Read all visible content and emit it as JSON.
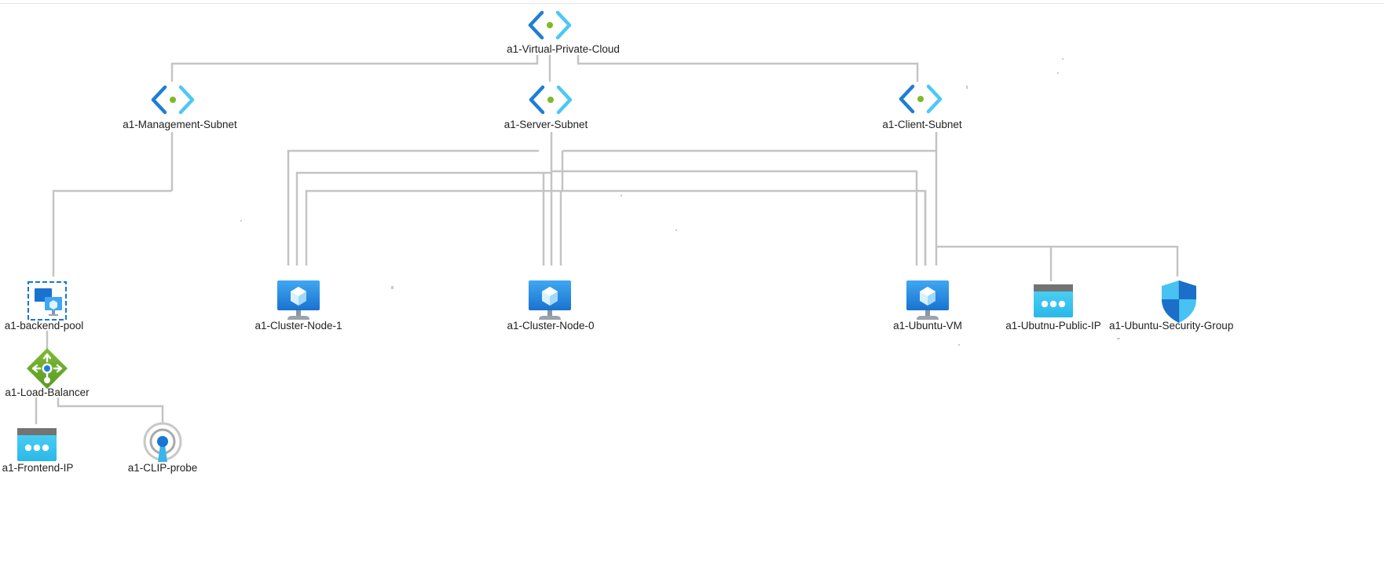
{
  "diagram": {
    "colors": {
      "connector": "#c4c4c4",
      "label_text": "#222222",
      "network_blue_dark": "#1e7ed6",
      "network_blue_light": "#4cc8f4",
      "network_dot": "#7fb927",
      "vm_screen": "#1e7ed6",
      "vm_screen_light": "#37a4f0",
      "vm_stand": "#9aa2ab",
      "lb_green": "#6aa529",
      "ip_teal": "#38c8ee",
      "ip_bar": "#737373",
      "shield_dark": "#1b6fc9",
      "shield_light": "#47c2f2",
      "probe_ring": "#b5b5b5",
      "probe_core": "#1a76d2"
    },
    "nodes": {
      "vpc": {
        "label": "a1-Virtual-Private-Cloud",
        "icon": "virtual-network-icon"
      },
      "mgmt_subnet": {
        "label": "a1-Management-Subnet",
        "icon": "subnet-icon"
      },
      "server_subnet": {
        "label": "a1-Server-Subnet",
        "icon": "subnet-icon"
      },
      "client_subnet": {
        "label": "a1-Client-Subnet",
        "icon": "subnet-icon"
      },
      "backend_pool": {
        "label": "a1-backend-pool",
        "icon": "backend-pool-icon"
      },
      "cluster_node_1": {
        "label": "a1-Cluster-Node-1",
        "icon": "virtual-machine-icon"
      },
      "cluster_node_0": {
        "label": "a1-Cluster-Node-0",
        "icon": "virtual-machine-icon"
      },
      "ubuntu_vm": {
        "label": "a1-Ubuntu-VM",
        "icon": "virtual-machine-icon"
      },
      "ubuntu_public_ip": {
        "label": "a1-Ubutnu-Public-IP",
        "icon": "public-ip-icon"
      },
      "ubuntu_security_group": {
        "label": "a1-Ubuntu-Security-Group",
        "icon": "network-security-group-icon"
      },
      "load_balancer": {
        "label": "a1-Load-Balancer",
        "icon": "load-balancer-icon"
      },
      "frontend_ip": {
        "label": "a1-Frontend-IP",
        "icon": "public-ip-icon"
      },
      "clip_probe": {
        "label": "a1-CLIP-probe",
        "icon": "health-probe-icon"
      }
    }
  }
}
